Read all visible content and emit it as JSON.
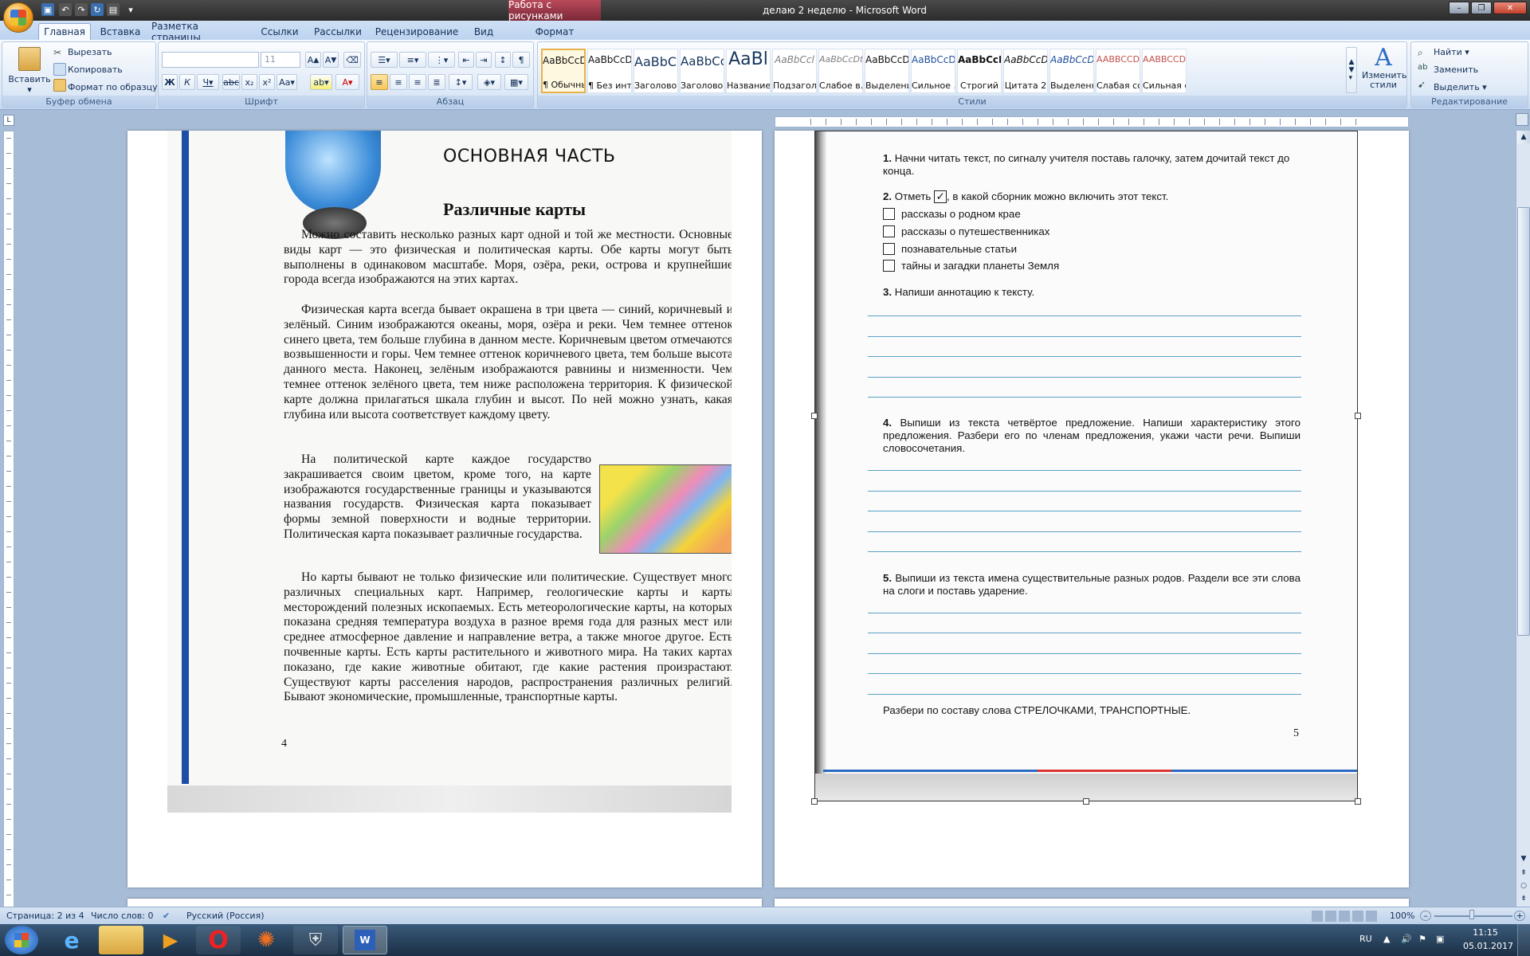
{
  "window": {
    "title": "делаю 2 неделю - Microsoft Word",
    "context_tab": "Работа с рисунками"
  },
  "tabs": [
    "Главная",
    "Вставка",
    "Разметка страницы",
    "Ссылки",
    "Рассылки",
    "Рецензирование",
    "Вид",
    "Формат"
  ],
  "ribbon": {
    "clipboard": {
      "label": "Буфер обмена",
      "paste": "Вставить",
      "cut": "Вырезать",
      "copy": "Копировать",
      "format_painter": "Формат по образцу"
    },
    "font": {
      "label": "Шрифт",
      "size": "11"
    },
    "paragraph": {
      "label": "Абзац"
    },
    "styles": {
      "label": "Стили",
      "items": [
        {
          "preview": "AaBbCcDc",
          "name": "¶ Обычный"
        },
        {
          "preview": "AaBbCcDc",
          "name": "¶ Без инте..."
        },
        {
          "preview": "AaBbCc",
          "name": "Заголово..."
        },
        {
          "preview": "AaBbCc",
          "name": "Заголово..."
        },
        {
          "preview": "AaBl",
          "name": "Название"
        },
        {
          "preview": "AaBbCcl",
          "name": "Подзагол..."
        },
        {
          "preview": "AaBbCcDt",
          "name": "Слабое в..."
        },
        {
          "preview": "AaBbCcDt",
          "name": "Выделение"
        },
        {
          "preview": "AaBbCcDt",
          "name": "Сильное ..."
        },
        {
          "preview": "AaBbCcDc",
          "name": "Строгий"
        },
        {
          "preview": "AaBbCcDt",
          "name": "Цитата 2"
        },
        {
          "preview": "AaBbCcDt",
          "name": "Выделенн..."
        },
        {
          "preview": "AABBCCDE",
          "name": "Слабая сс..."
        },
        {
          "preview": "AABBCCDE",
          "name": "Сильная с..."
        }
      ],
      "change_styles": "Изменить стили"
    },
    "editing": {
      "label": "Редактирование",
      "find": "Найти",
      "replace": "Заменить",
      "select": "Выделить"
    }
  },
  "book_left": {
    "section": "ОСНОВНАЯ ЧАСТЬ",
    "title": "Различные карты",
    "p1": "Можно составить несколько разных карт одной и той же местности. Основные виды карт — это физическая и политическая карты. Обе карты могут быть выполнены в одинаковом масштабе. Моря, озёра, реки, острова и крупнейшие города всегда изображаются на этих картах.",
    "p2": "Физическая карта всегда бывает окрашена в три цвета — синий, коричневый и зелёный. Синим изображаются океаны, моря, озёра и реки. Чем темнее оттенок синего цвета, тем больше глубина в данном месте. Коричневым цветом отмечаются возвышенности и горы. Чем темнее оттенок коричневого цвета, тем больше высота данного места. Наконец, зелёным изображаются равнины и низменности. Чем темнее оттенок зелёного цвета, тем ниже расположена территория. К физической карте должна прилагаться шкала глубин и высот. По ней можно узнать, какая глубина или высота соответствует каждому цвету.",
    "p3": "На политической карте каждое государство закрашивается своим цветом, кроме того, на карте изображаются государственные границы и указываются названия государств. Физическая карта показывает формы земной поверхности и водные территории. Политическая карта показывает различные государства.",
    "p4": "Но карты бывают не только физические или политические. Существует много различных специальных карт. Например, геологические карты и карты месторождений полезных ископаемых. Есть метеорологические карты, на которых показана средняя температура воздуха в разное время года для разных мест или среднее атмосферное давление и направление ветра, а также многое другое. Есть почвенные карты. Есть карты растительного и животного мира. На таких картах показано, где какие животные обитают, где какие растения произрастают. Существуют карты расселения народов, распространения различных религий. Бывают экономические, промышленные, транспортные карты.",
    "page_no": "4"
  },
  "book_right": {
    "q1_num": "1.",
    "q1": "Начни читать текст, по сигналу учителя поставь галочку, затем дочитай текст до конца.",
    "q2_num": "2.",
    "q2_a": "Отметь",
    "q2_check": "✓",
    "q2_b": ", в какой сборник можно включить этот текст.",
    "options": [
      "рассказы о родном крае",
      "рассказы о путешественниках",
      "познавательные статьи",
      "тайны и загадки планеты Земля"
    ],
    "q3_num": "3.",
    "q3": "Напиши аннотацию к тексту.",
    "q4_num": "4.",
    "q4": "Выпиши из текста четвёртое предложение. Напиши характеристику этого предложения. Разбери его по членам предложения, укажи части речи. Выпиши словосочетания.",
    "q5_num": "5.",
    "q5": "Выпиши из текста имена существительные разных родов. Раздели все эти слова на слоги и поставь ударение.",
    "task6": "Разбери по составу слова СТРЕЛОЧКАМИ, ТРАНСПОРТНЫЕ.",
    "page_no": "5"
  },
  "status": {
    "page": "Страница: 2 из 4",
    "words": "Число слов: 0",
    "language": "Русский (Россия)",
    "zoom": "100%"
  },
  "tray": {
    "lang": "RU",
    "time": "11:15",
    "date": "05.01.2017"
  }
}
